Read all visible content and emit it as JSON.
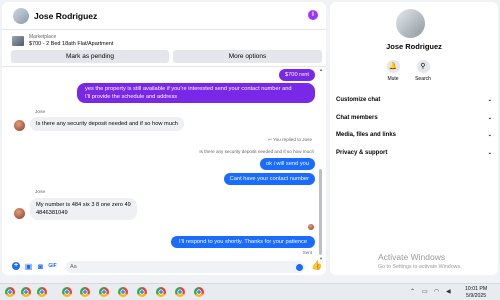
{
  "chat": {
    "contact_name": "Jose Rodriguez",
    "listing": {
      "source": "Marketplace",
      "title": "$700 - 2 Bed 18ath Flat/Apartment"
    },
    "buttons": {
      "pending": "Mark as pending",
      "more": "More options"
    },
    "messages": {
      "m1": "$700 rent",
      "m2_line1": "yes the property is still available if you're interested send your contact number and",
      "m2_line2": "I'll provide the schedule and address",
      "sender1": "Jose",
      "m3": "Is there any security deposit needed and if so how much",
      "replied": "You replied to Jose",
      "quoted": "Is there any security deposit needed and if so how much",
      "m4": "ok i will send you",
      "m5": "Cant have your contact number",
      "sender2": "Jose",
      "m6_line1": "My number is 484 six 3 8 one zero 49",
      "m6_line2": "4846381049",
      "m7": "I'll respond to you shortly. Thanks for your patience",
      "sent": "Sent"
    },
    "composer": {
      "placeholder": "Aa"
    }
  },
  "info": {
    "name": "Jose Rodriguez",
    "actions": {
      "mute": "Mute",
      "search": "Search"
    },
    "menu": [
      "Customize chat",
      "Chat members",
      "Media, files and links",
      "Privacy & support"
    ],
    "watermark_title": "Activate Windows",
    "watermark_sub": "Go to Settings to activate Windows."
  },
  "taskbar": {
    "time": "10:01 PM",
    "date": "5/9/2025"
  },
  "colors": {
    "purple_bubble": "#7a28e8",
    "blue_bubble": "#1a6bff",
    "incoming_bubble": "#eef0f3"
  }
}
